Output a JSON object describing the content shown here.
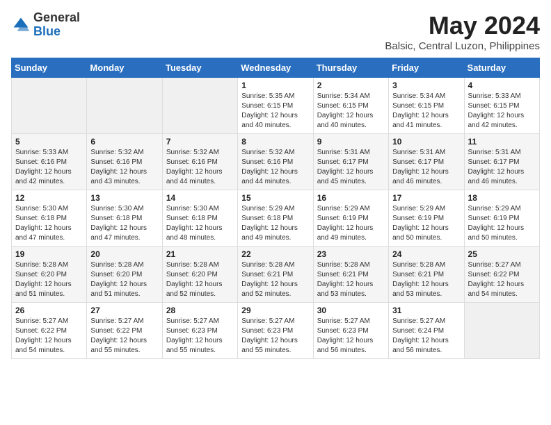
{
  "header": {
    "logo_general": "General",
    "logo_blue": "Blue",
    "month_year": "May 2024",
    "location": "Balsic, Central Luzon, Philippines"
  },
  "weekdays": [
    "Sunday",
    "Monday",
    "Tuesday",
    "Wednesday",
    "Thursday",
    "Friday",
    "Saturday"
  ],
  "weeks": [
    [
      {
        "day": null,
        "sunrise": null,
        "sunset": null,
        "daylight": null
      },
      {
        "day": null,
        "sunrise": null,
        "sunset": null,
        "daylight": null
      },
      {
        "day": null,
        "sunrise": null,
        "sunset": null,
        "daylight": null
      },
      {
        "day": "1",
        "sunrise": "5:35 AM",
        "sunset": "6:15 PM",
        "daylight": "12 hours and 40 minutes."
      },
      {
        "day": "2",
        "sunrise": "5:34 AM",
        "sunset": "6:15 PM",
        "daylight": "12 hours and 40 minutes."
      },
      {
        "day": "3",
        "sunrise": "5:34 AM",
        "sunset": "6:15 PM",
        "daylight": "12 hours and 41 minutes."
      },
      {
        "day": "4",
        "sunrise": "5:33 AM",
        "sunset": "6:15 PM",
        "daylight": "12 hours and 42 minutes."
      }
    ],
    [
      {
        "day": "5",
        "sunrise": "5:33 AM",
        "sunset": "6:16 PM",
        "daylight": "12 hours and 42 minutes."
      },
      {
        "day": "6",
        "sunrise": "5:32 AM",
        "sunset": "6:16 PM",
        "daylight": "12 hours and 43 minutes."
      },
      {
        "day": "7",
        "sunrise": "5:32 AM",
        "sunset": "6:16 PM",
        "daylight": "12 hours and 44 minutes."
      },
      {
        "day": "8",
        "sunrise": "5:32 AM",
        "sunset": "6:16 PM",
        "daylight": "12 hours and 44 minutes."
      },
      {
        "day": "9",
        "sunrise": "5:31 AM",
        "sunset": "6:17 PM",
        "daylight": "12 hours and 45 minutes."
      },
      {
        "day": "10",
        "sunrise": "5:31 AM",
        "sunset": "6:17 PM",
        "daylight": "12 hours and 46 minutes."
      },
      {
        "day": "11",
        "sunrise": "5:31 AM",
        "sunset": "6:17 PM",
        "daylight": "12 hours and 46 minutes."
      }
    ],
    [
      {
        "day": "12",
        "sunrise": "5:30 AM",
        "sunset": "6:18 PM",
        "daylight": "12 hours and 47 minutes."
      },
      {
        "day": "13",
        "sunrise": "5:30 AM",
        "sunset": "6:18 PM",
        "daylight": "12 hours and 47 minutes."
      },
      {
        "day": "14",
        "sunrise": "5:30 AM",
        "sunset": "6:18 PM",
        "daylight": "12 hours and 48 minutes."
      },
      {
        "day": "15",
        "sunrise": "5:29 AM",
        "sunset": "6:18 PM",
        "daylight": "12 hours and 49 minutes."
      },
      {
        "day": "16",
        "sunrise": "5:29 AM",
        "sunset": "6:19 PM",
        "daylight": "12 hours and 49 minutes."
      },
      {
        "day": "17",
        "sunrise": "5:29 AM",
        "sunset": "6:19 PM",
        "daylight": "12 hours and 50 minutes."
      },
      {
        "day": "18",
        "sunrise": "5:29 AM",
        "sunset": "6:19 PM",
        "daylight": "12 hours and 50 minutes."
      }
    ],
    [
      {
        "day": "19",
        "sunrise": "5:28 AM",
        "sunset": "6:20 PM",
        "daylight": "12 hours and 51 minutes."
      },
      {
        "day": "20",
        "sunrise": "5:28 AM",
        "sunset": "6:20 PM",
        "daylight": "12 hours and 51 minutes."
      },
      {
        "day": "21",
        "sunrise": "5:28 AM",
        "sunset": "6:20 PM",
        "daylight": "12 hours and 52 minutes."
      },
      {
        "day": "22",
        "sunrise": "5:28 AM",
        "sunset": "6:21 PM",
        "daylight": "12 hours and 52 minutes."
      },
      {
        "day": "23",
        "sunrise": "5:28 AM",
        "sunset": "6:21 PM",
        "daylight": "12 hours and 53 minutes."
      },
      {
        "day": "24",
        "sunrise": "5:28 AM",
        "sunset": "6:21 PM",
        "daylight": "12 hours and 53 minutes."
      },
      {
        "day": "25",
        "sunrise": "5:27 AM",
        "sunset": "6:22 PM",
        "daylight": "12 hours and 54 minutes."
      }
    ],
    [
      {
        "day": "26",
        "sunrise": "5:27 AM",
        "sunset": "6:22 PM",
        "daylight": "12 hours and 54 minutes."
      },
      {
        "day": "27",
        "sunrise": "5:27 AM",
        "sunset": "6:22 PM",
        "daylight": "12 hours and 55 minutes."
      },
      {
        "day": "28",
        "sunrise": "5:27 AM",
        "sunset": "6:23 PM",
        "daylight": "12 hours and 55 minutes."
      },
      {
        "day": "29",
        "sunrise": "5:27 AM",
        "sunset": "6:23 PM",
        "daylight": "12 hours and 55 minutes."
      },
      {
        "day": "30",
        "sunrise": "5:27 AM",
        "sunset": "6:23 PM",
        "daylight": "12 hours and 56 minutes."
      },
      {
        "day": "31",
        "sunrise": "5:27 AM",
        "sunset": "6:24 PM",
        "daylight": "12 hours and 56 minutes."
      },
      {
        "day": null,
        "sunrise": null,
        "sunset": null,
        "daylight": null
      }
    ]
  ]
}
